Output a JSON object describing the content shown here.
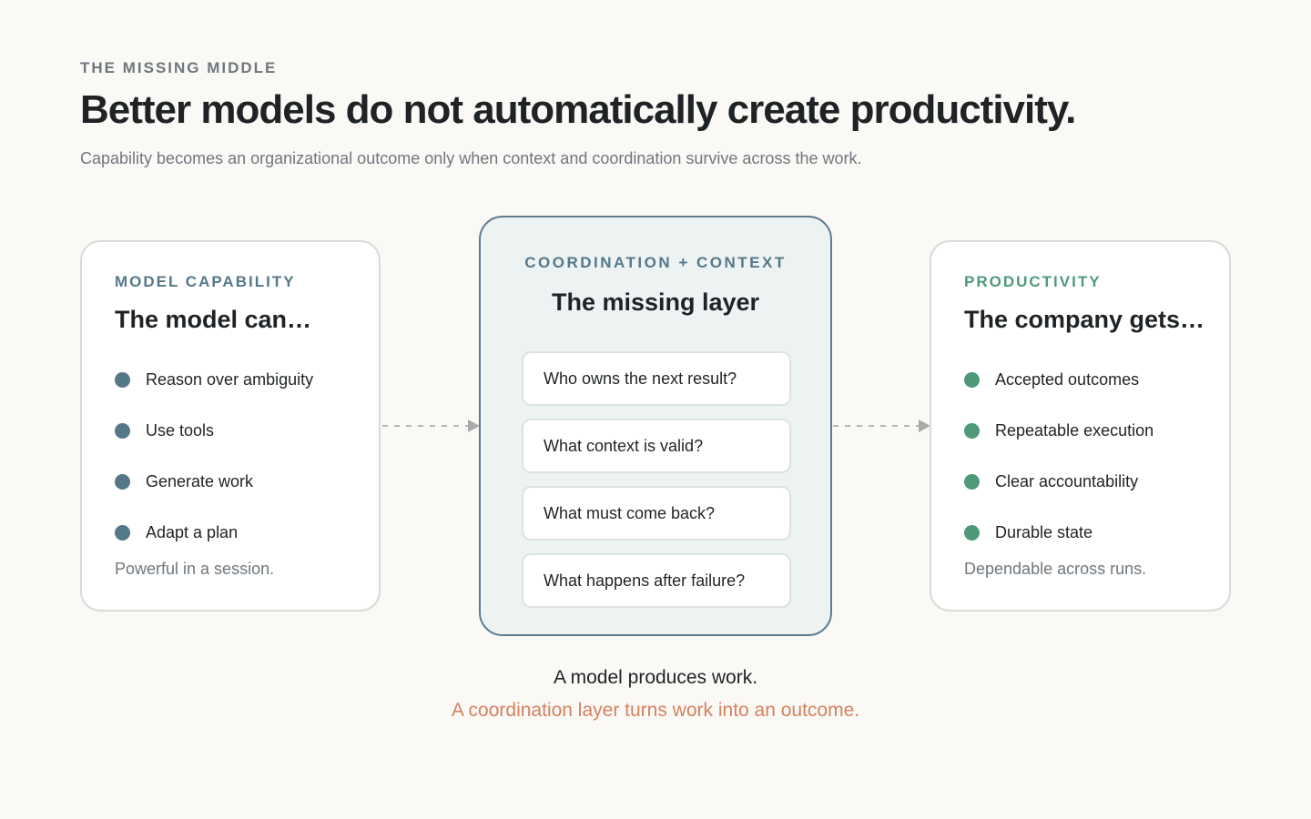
{
  "header": {
    "eyebrow": "THE MISSING MIDDLE",
    "headline": "Better models do not automatically create productivity.",
    "subhead": "Capability becomes an organizational outcome only when context and coordination survive across the work."
  },
  "left_card": {
    "label": "MODEL CAPABILITY",
    "title": "The model can…",
    "items": [
      "Reason over ambiguity",
      "Use tools",
      "Generate work",
      "Adapt a plan"
    ],
    "note": "Powerful in a session."
  },
  "middle_card": {
    "label": "COORDINATION + CONTEXT",
    "title": "The missing layer",
    "questions": [
      "Who owns the next result?",
      "What context is valid?",
      "What must come back?",
      "What happens after failure?"
    ]
  },
  "right_card": {
    "label": "PRODUCTIVITY",
    "title": "The company gets…",
    "items": [
      "Accepted outcomes",
      "Repeatable execution",
      "Clear accountability",
      "Durable state"
    ],
    "note": "Dependable across runs."
  },
  "footer": {
    "line1": "A model produces work.",
    "line2": "A coordination layer turns work into an outcome."
  },
  "colors": {
    "background": "#faf9f6",
    "capability_accent": "#54788a",
    "productivity_accent": "#4e9a78",
    "middle_fill": "#edf2f2",
    "middle_border": "#5e7b8e",
    "highlight_text": "#d4825f"
  }
}
